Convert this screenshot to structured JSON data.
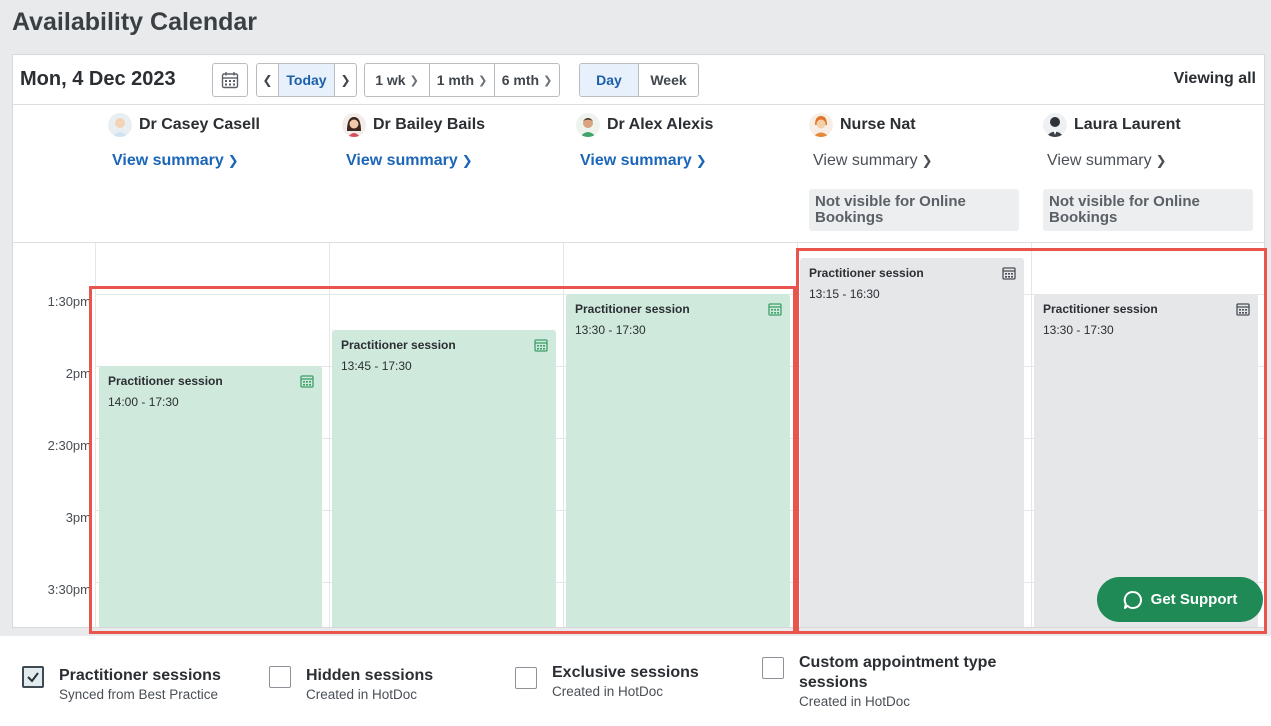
{
  "page_title": "Availability Calendar",
  "toolbar": {
    "date": "Mon, 4 Dec 2023",
    "today_label": "Today",
    "range_buttons": [
      "1 wk",
      "1 mth",
      "6 mth"
    ],
    "view_day": "Day",
    "view_week": "Week",
    "viewing": "Viewing all"
  },
  "practitioners": [
    {
      "name": "Dr Casey Casell",
      "summary": "View summary",
      "not_visible": ""
    },
    {
      "name": "Dr Bailey Bails",
      "summary": "View summary",
      "not_visible": ""
    },
    {
      "name": "Dr Alex Alexis",
      "summary": "View summary",
      "not_visible": ""
    },
    {
      "name": "Nurse Nat",
      "summary": "View summary",
      "not_visible": "Not visible for Online Bookings"
    },
    {
      "name": "Laura Laurent",
      "summary": "View summary",
      "not_visible": "Not visible for Online Bookings"
    }
  ],
  "time_labels": [
    "1:30pm",
    "2pm",
    "2:30pm",
    "3pm",
    "3:30pm"
  ],
  "sessions": [
    {
      "title": "Practitioner session",
      "time": "14:00 - 17:30"
    },
    {
      "title": "Practitioner session",
      "time": "13:45 - 17:30"
    },
    {
      "title": "Practitioner session",
      "time": "13:30 - 17:30"
    },
    {
      "title": "Practitioner session",
      "time": "13:15 - 16:30"
    },
    {
      "title": "Practitioner session",
      "time": "13:30 - 17:30"
    }
  ],
  "support": {
    "label": "Get Support"
  },
  "legend": [
    {
      "title": "Practitioner sessions",
      "sub": "Synced from Best Practice",
      "checked": true
    },
    {
      "title": "Hidden sessions",
      "sub": "Created in HotDoc",
      "checked": false
    },
    {
      "title": "Exclusive sessions",
      "sub": "Created in HotDoc",
      "checked": false
    },
    {
      "title": "Custom appointment type sessions",
      "sub": "Created in HotDoc",
      "checked": false
    }
  ],
  "colors": {
    "accent": "#1b66b8",
    "green_session": "#cfe9dc",
    "grey_session": "#e6e7e9",
    "highlight": "#e9544d",
    "support": "#1f8a55"
  }
}
